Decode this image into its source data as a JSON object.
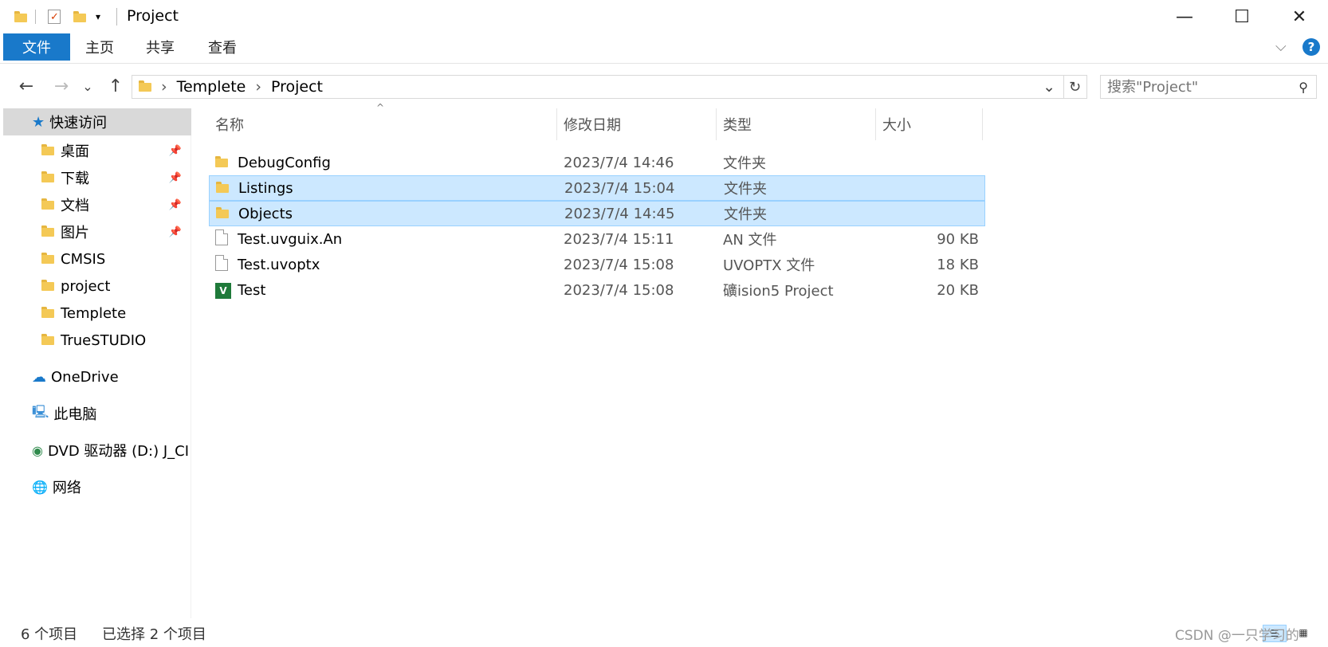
{
  "window": {
    "title": "Project",
    "minimize_glyph": "—",
    "maximize_glyph": "☐",
    "close_glyph": "✕"
  },
  "ribbon": {
    "tabs": [
      "文件",
      "主页",
      "共享",
      "查看"
    ],
    "expand_glyph": "⌵",
    "help_glyph": "?"
  },
  "address": {
    "back_glyph": "←",
    "forward_glyph": "→",
    "recent_glyph": "⌄",
    "up_glyph": "↑",
    "crumbs": [
      "Templete",
      "Project"
    ],
    "separator": "›",
    "dropdown_glyph": "⌄",
    "refresh_glyph": "↻"
  },
  "search": {
    "placeholder": "搜索\"Project\""
  },
  "sidebar": {
    "quick_access": "快速访问",
    "pinned": [
      "桌面",
      "下载",
      "文档",
      "图片"
    ],
    "pin_glyph": "📌",
    "folders": [
      "CMSIS",
      "project",
      "Templete",
      "TrueSTUDIO"
    ],
    "onedrive": "OneDrive",
    "this_pc": "此电脑",
    "dvd": "DVD 驱动器 (D:) J_CI",
    "network": "网络"
  },
  "columns": {
    "name": "名称",
    "date": "修改日期",
    "type": "类型",
    "size": "大小",
    "sort_glyph": "^"
  },
  "files": [
    {
      "name": "DebugConfig",
      "date": "2023/7/4 14:46",
      "type": "文件夹",
      "size": "",
      "icon": "folder-icon",
      "selected": false
    },
    {
      "name": "Listings",
      "date": "2023/7/4 15:04",
      "type": "文件夹",
      "size": "",
      "icon": "folder-icon",
      "selected": true
    },
    {
      "name": "Objects",
      "date": "2023/7/4 14:45",
      "type": "文件夹",
      "size": "",
      "icon": "folder-icon",
      "selected": true
    },
    {
      "name": "Test.uvguix.An",
      "date": "2023/7/4 15:11",
      "type": "AN 文件",
      "size": "90 KB",
      "icon": "file-icon",
      "selected": false
    },
    {
      "name": "Test.uvoptx",
      "date": "2023/7/4 15:08",
      "type": "UVOPTX 文件",
      "size": "18 KB",
      "icon": "file-icon",
      "selected": false
    },
    {
      "name": "Test",
      "date": "2023/7/4 15:08",
      "type": "礦ision5 Project",
      "size": "20 KB",
      "icon": "uvision-icon",
      "selected": false
    }
  ],
  "status": {
    "count": "6 个项目",
    "selected": "已选择 2 个项目"
  },
  "watermark": "CSDN @一只学习的"
}
